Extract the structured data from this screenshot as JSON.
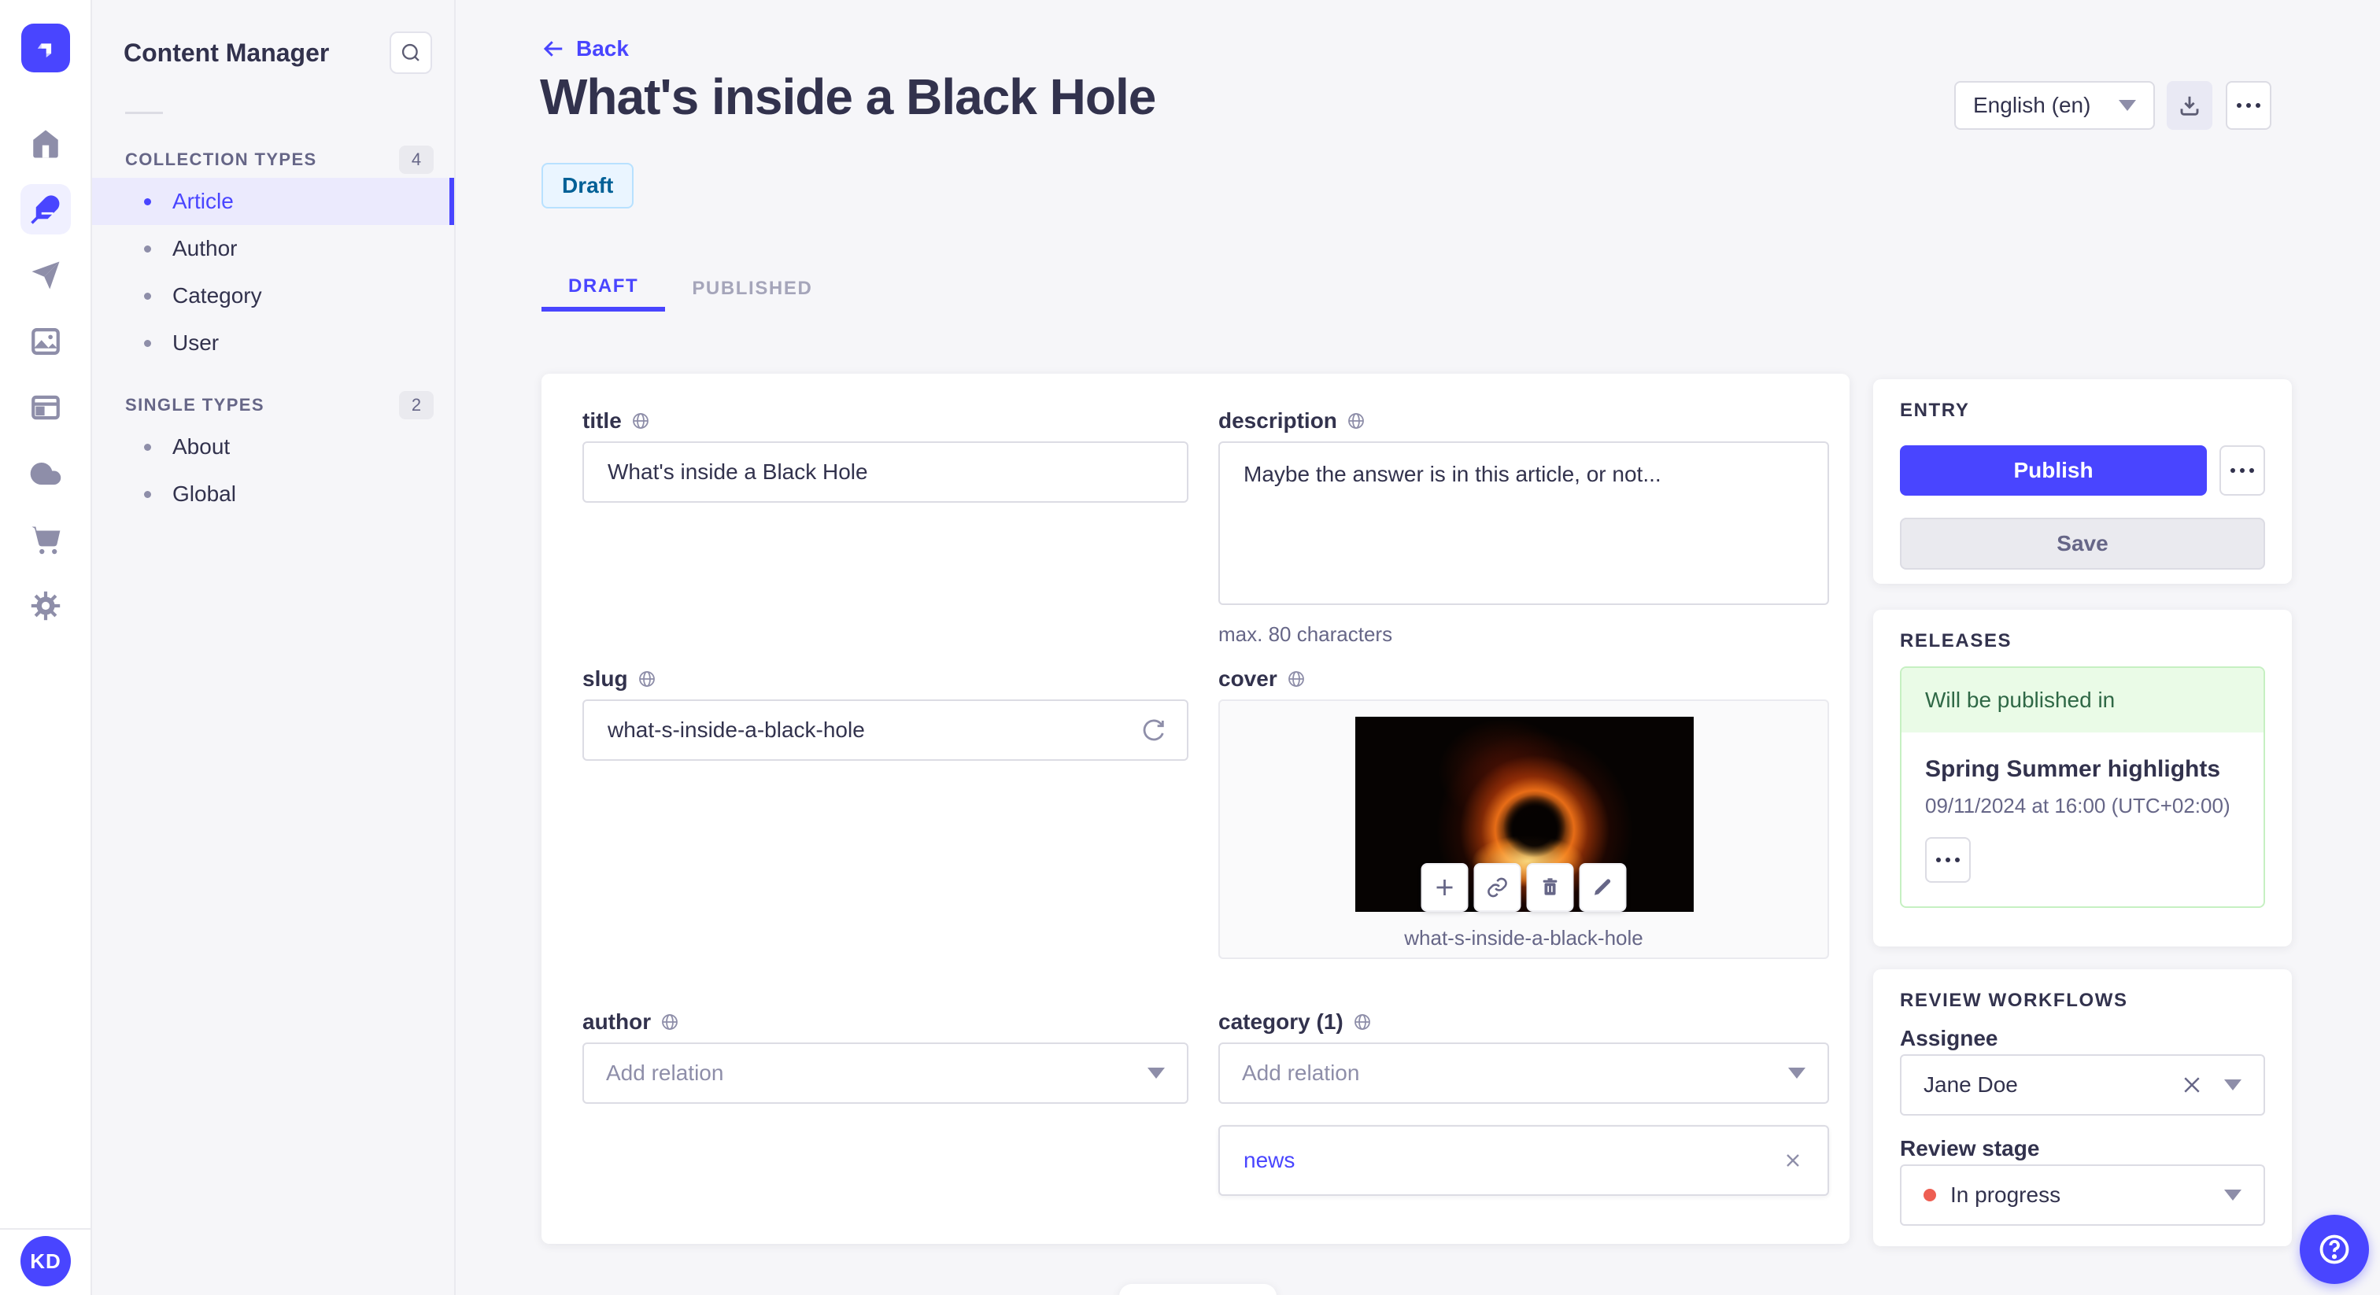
{
  "nav": {
    "title": "Content Manager",
    "sections": [
      {
        "label": "COLLECTION TYPES",
        "count": "4",
        "items": [
          {
            "label": "Article"
          },
          {
            "label": "Author"
          },
          {
            "label": "Category"
          },
          {
            "label": "User"
          }
        ]
      },
      {
        "label": "SINGLE TYPES",
        "count": "2",
        "items": [
          {
            "label": "About"
          },
          {
            "label": "Global"
          }
        ]
      }
    ]
  },
  "iconbar": {
    "avatar": "KD",
    "icons": [
      "home",
      "content-manager",
      "releases",
      "media-library",
      "content-type-builder",
      "cloud",
      "marketplace",
      "settings"
    ]
  },
  "header": {
    "back": "Back",
    "title": "What's inside a Black Hole",
    "status": "Draft",
    "locale": "English (en)",
    "tabs": [
      {
        "label": "DRAFT"
      },
      {
        "label": "PUBLISHED"
      }
    ]
  },
  "form": {
    "title": {
      "label": "title",
      "value": "What's inside a Black Hole"
    },
    "description": {
      "label": "description",
      "value": "Maybe the answer is in this article, or not...",
      "hint": "max. 80 characters"
    },
    "slug": {
      "label": "slug",
      "value": "what-s-inside-a-black-hole"
    },
    "cover": {
      "label": "cover",
      "caption": "what-s-inside-a-black-hole"
    },
    "author": {
      "label": "author",
      "placeholder": "Add relation"
    },
    "category": {
      "label": "category (1)",
      "placeholder": "Add relation",
      "relations": [
        {
          "label": "news"
        }
      ]
    }
  },
  "entry": {
    "title": "ENTRY",
    "publish": "Publish",
    "save": "Save"
  },
  "releases": {
    "title": "RELEASES",
    "banner": "Will be published in",
    "name": "Spring Summer highlights",
    "date": "09/11/2024 at 16:00 (UTC+02:00)"
  },
  "review": {
    "title": "REVIEW WORKFLOWS",
    "assignee_label": "Assignee",
    "assignee": "Jane Doe",
    "stage_label": "Review stage",
    "stage": "In progress"
  },
  "colors": {
    "accent": "#4945ff",
    "draft_bg": "#eaf5ff",
    "draft_border": "#b8e1ff",
    "draft_text": "#006096",
    "success_bg": "#eafbe7",
    "success_border": "#c6f0c2",
    "success_text": "#2f6846",
    "stage_dot": "#ee5e52"
  }
}
